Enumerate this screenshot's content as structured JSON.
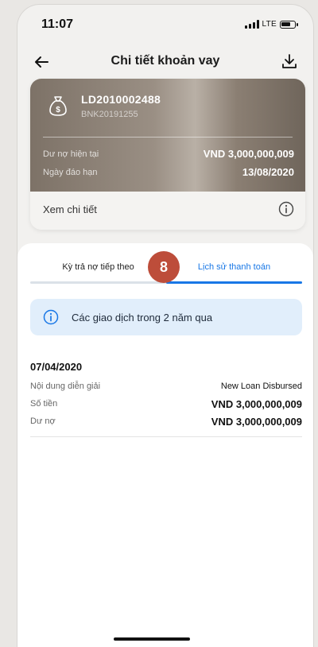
{
  "status_bar": {
    "time": "11:07",
    "network": "LTE",
    "icons": [
      "signal-icon",
      "battery-icon"
    ]
  },
  "header": {
    "title": "Chi tiết khoản vay",
    "icons": {
      "back": "arrow-left-icon",
      "download": "download-icon"
    }
  },
  "loan_card": {
    "icon": "money-bag-icon",
    "loan_id": "LD2010002488",
    "account": "BNK20191255",
    "rows": [
      {
        "label": "Dư nợ hiện tại",
        "value": "VND 3,000,000,009"
      },
      {
        "label": "Ngày đáo hạn",
        "value": "13/08/2020"
      }
    ],
    "detail_link": "Xem chi tiết",
    "detail_icon": "info-icon"
  },
  "tabs": [
    {
      "label": "Kỳ trả nợ tiếp theo",
      "active": false
    },
    {
      "label": "Lịch sử thanh toán",
      "active": true
    }
  ],
  "step_badge": "8",
  "notice": {
    "icon": "info-icon",
    "text": "Các giao dịch trong 2 năm qua"
  },
  "transactions": [
    {
      "date": "07/04/2020",
      "rows": [
        {
          "label": "Nội dung diễn giải",
          "value": "New Loan Disbursed"
        },
        {
          "label": "Số tiền",
          "value": "VND 3,000,000,009"
        },
        {
          "label": "Dư nợ",
          "value": "VND 3,000,000,009"
        }
      ]
    }
  ],
  "colors": {
    "accent": "#1877e6",
    "badge": "#bd4d3a",
    "notice_bg": "#e1eefb"
  }
}
